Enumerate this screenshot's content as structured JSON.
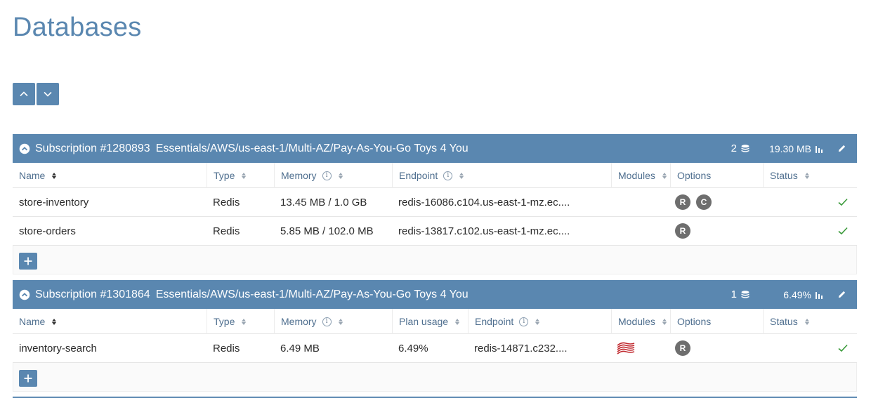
{
  "page": {
    "title": "Databases"
  },
  "subscriptions": [
    {
      "id": "Subscription #1280893",
      "plan": "Essentials/AWS/us-east-1/Multi-AZ/Pay-As-You-Go Toys 4 You",
      "db_count": "2",
      "usage": "19.30 MB",
      "columns": [
        "Name",
        "Type",
        "Memory",
        "Endpoint",
        "Modules",
        "Options",
        "Status"
      ],
      "rows": [
        {
          "name": "store-inventory",
          "type": "Redis",
          "memory": "13.45 MB / 1.0 GB",
          "endpoint": "redis-16086.c104.us-east-1-mz.ec....",
          "options": [
            "R",
            "C"
          ]
        },
        {
          "name": "store-orders",
          "type": "Redis",
          "memory": "5.85 MB / 102.0 MB",
          "endpoint": "redis-13817.c102.us-east-1-mz.ec....",
          "options": [
            "R"
          ]
        }
      ]
    },
    {
      "id": "Subscription #1301864",
      "plan": "Essentials/AWS/us-east-1/Multi-AZ/Pay-As-You-Go Toys 4 You",
      "db_count": "1",
      "usage": "6.49%",
      "columns": [
        "Name",
        "Type",
        "Memory",
        "Plan usage",
        "Endpoint",
        "Modules",
        "Options",
        "Status"
      ],
      "rows": [
        {
          "name": "inventory-search",
          "type": "Redis",
          "memory": "6.49 MB",
          "plan_usage": "6.49%",
          "endpoint": "redis-14871.c232....",
          "module_icon": "redisearch-icon",
          "options": [
            "R"
          ]
        }
      ]
    }
  ],
  "colors": {
    "accent": "#5a87b0",
    "status_ok": "#3a9a3a",
    "badge": "#6e6e6e",
    "module": "#c0272d"
  }
}
